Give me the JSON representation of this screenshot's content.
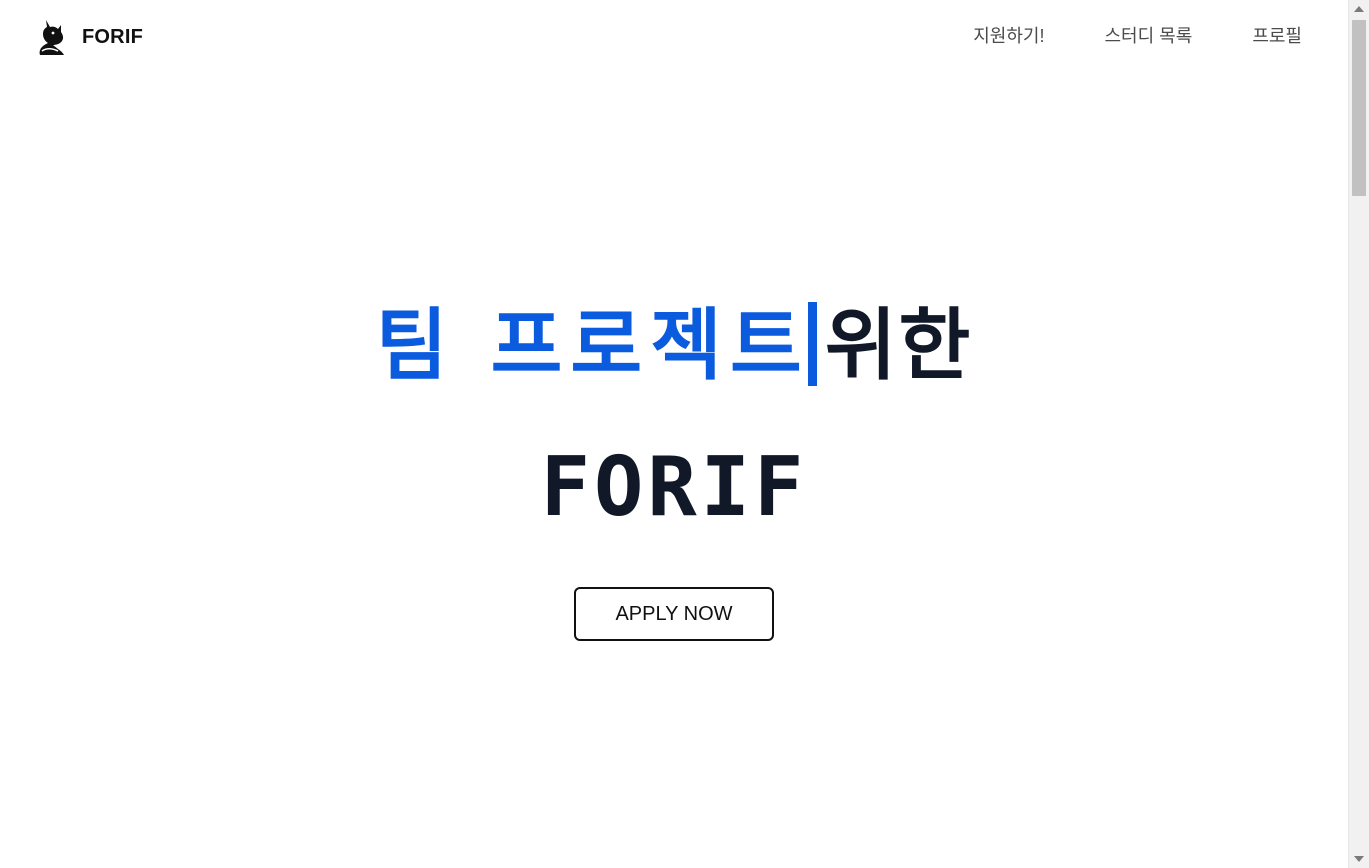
{
  "brand": {
    "name": "FORIF",
    "logo_icon": "fox-logo-icon"
  },
  "nav": {
    "items": [
      {
        "label": "지원하기!"
      },
      {
        "label": "스터디 목록"
      },
      {
        "label": "프로필"
      }
    ]
  },
  "hero": {
    "typed_text": "팀 프로젝트",
    "suffix_text": "위한",
    "title": "FORIF",
    "cta_label": "APPLY NOW"
  },
  "colors": {
    "accent": "#0b5bde",
    "heading": "#111827",
    "nav_text": "#4b4b4b"
  }
}
